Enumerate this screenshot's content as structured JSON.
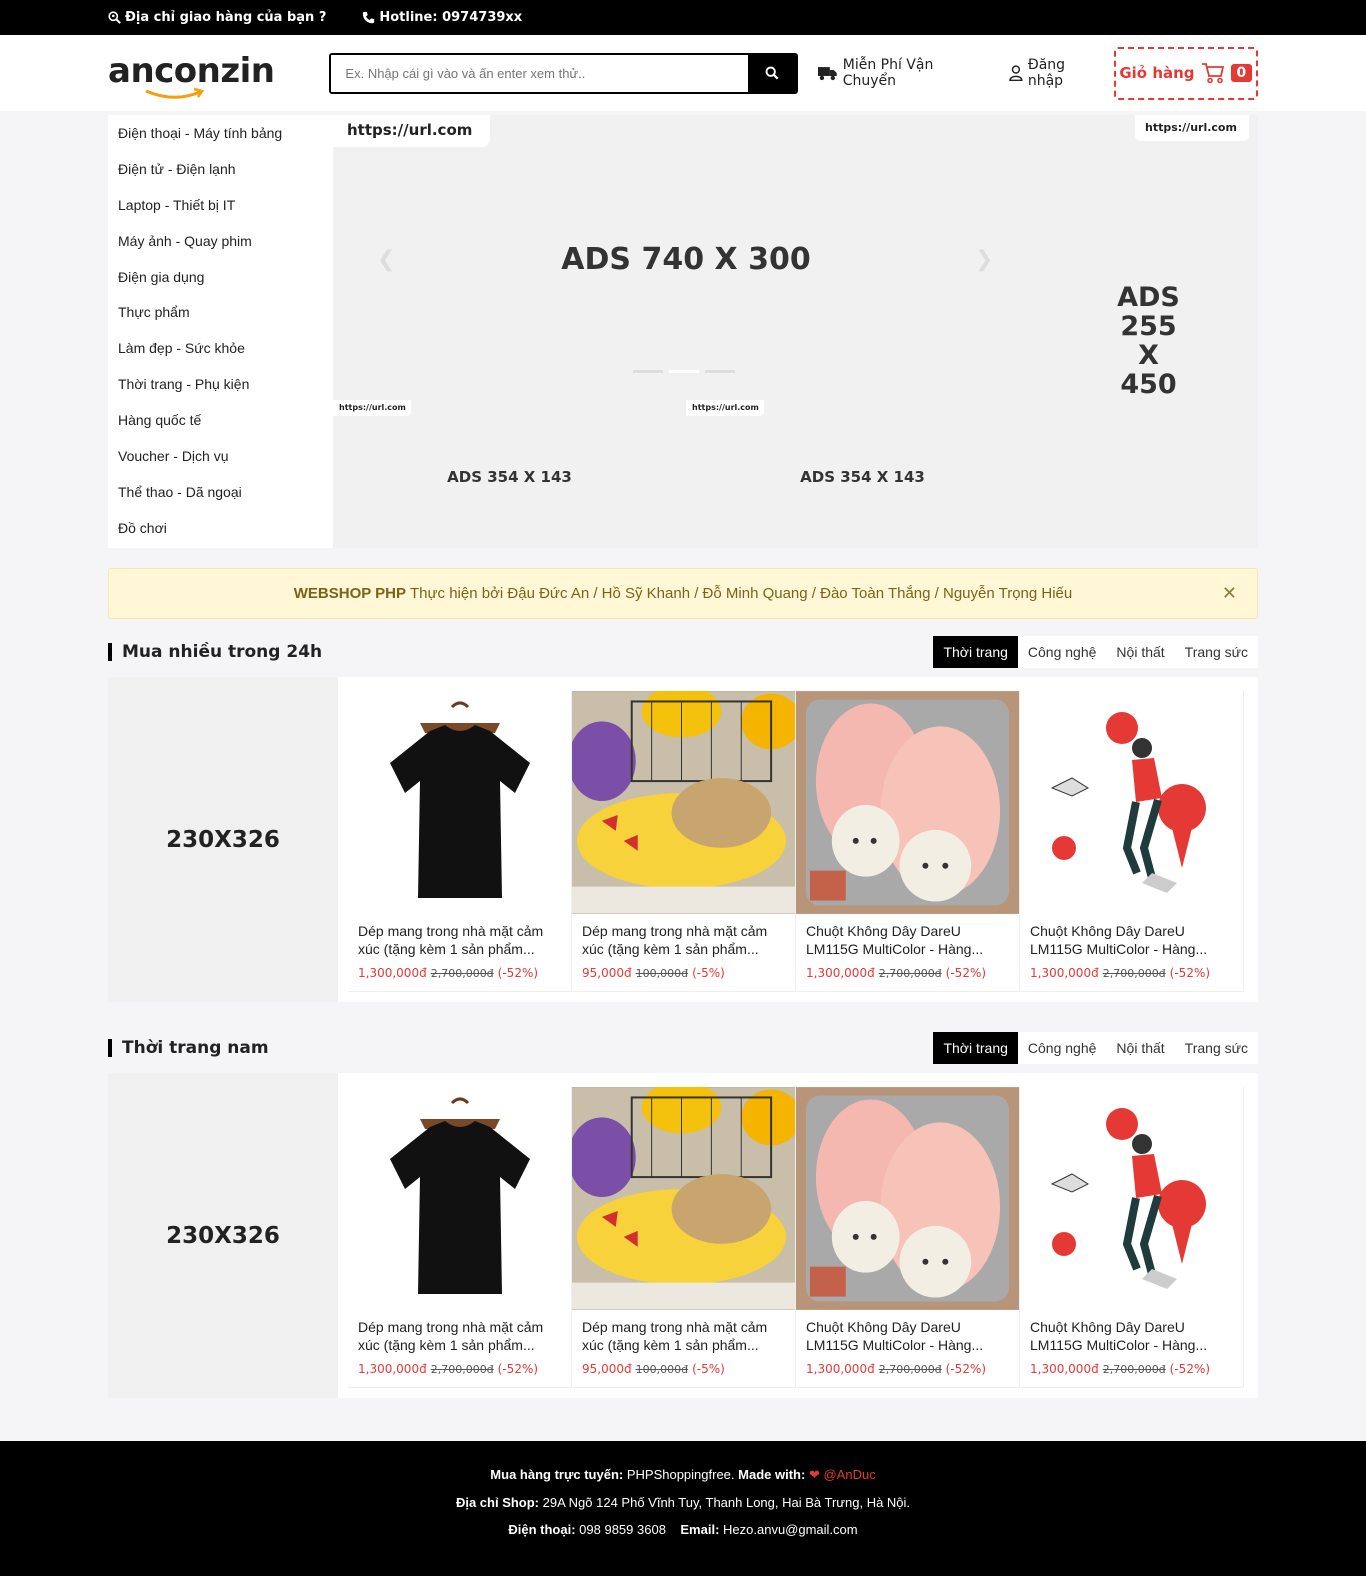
{
  "topbar": {
    "address": "Địa chỉ giao hàng của bạn ?",
    "hotline": "Hotline: 0974739xx"
  },
  "header": {
    "logo": "anconzin",
    "search_placeholder": "Ex. Nhập cái gì vào và ấn enter xem thử..",
    "shipping": "Miễn Phí Vận Chuyển",
    "login": "Đăng nhập",
    "cart_label": "Giỏ hàng",
    "cart_count": "0"
  },
  "menu": [
    "Điện thoại - Máy tính bảng",
    "Điện tử - Điện lạnh",
    "Laptop - Thiết bị IT",
    "Máy ảnh - Quay phim",
    "Điện gia dụng",
    "Thực phẩm",
    "Làm đẹp - Sức khỏe",
    "Thời trang - Phụ kiện",
    "Hàng quốc tế",
    "Voucher - Dịch vụ",
    "Thể thao - Dã ngoại",
    "Đồ chơi"
  ],
  "banners": {
    "main_url": "https://url.com",
    "main_text": "ADS 740 X 300",
    "small": [
      {
        "url": "https://url.com",
        "text": "ADS 354 X 143"
      },
      {
        "url": "https://url.com",
        "text": "ADS 354 X 143"
      }
    ],
    "right_url": "https://url.com",
    "right_text": [
      "ADS",
      "255",
      "X",
      "450"
    ]
  },
  "notice": {
    "brand": "WEBSHOP PHP",
    "text": "Thực hiện bởi Đậu Đức An / Hồ Sỹ Khanh / Đỗ Minh Quang / Đào Toàn Thắng / Nguyễn Trọng Hiếu"
  },
  "sections": [
    {
      "title": "Mua nhiều trong 24h",
      "tabs": [
        "Thời trang",
        "Công nghệ",
        "Nội thất",
        "Trang sức"
      ],
      "promo": "230X326",
      "products": [
        {
          "image": "tshirt",
          "name": "Dép mang trong nhà mặt cảm xúc (tặng kèm 1 sản phẩm...",
          "price": "1,300,000đ",
          "old": "2,700,000đ",
          "discount": "(-52%)"
        },
        {
          "image": "emoji-slipper",
          "name": "Dép mang trong nhà mặt cảm xúc (tặng kèm 1 sản phẩm...",
          "price": "95,000đ",
          "old": "100,000đ",
          "discount": "(-5%)"
        },
        {
          "image": "bear-slipper",
          "name": "Chuột Không Dây DareU LM115G MultiColor - Hàng...",
          "price": "1,300,000đ",
          "old": "2,700,000đ",
          "discount": "(-52%)"
        },
        {
          "image": "idea-illustration",
          "name": "Chuột Không Dây DareU LM115G MultiColor - Hàng...",
          "price": "1,300,000đ",
          "old": "2,700,000đ",
          "discount": "(-52%)"
        }
      ]
    },
    {
      "title": "Thời trang nam",
      "tabs": [
        "Thời trang",
        "Công nghệ",
        "Nội thất",
        "Trang sức"
      ],
      "promo": "230X326",
      "products": [
        {
          "image": "tshirt",
          "name": "Dép mang trong nhà mặt cảm xúc (tặng kèm 1 sản phẩm...",
          "price": "1,300,000đ",
          "old": "2,700,000đ",
          "discount": "(-52%)"
        },
        {
          "image": "emoji-slipper",
          "name": "Dép mang trong nhà mặt cảm xúc (tặng kèm 1 sản phẩm...",
          "price": "95,000đ",
          "old": "100,000đ",
          "discount": "(-5%)"
        },
        {
          "image": "bear-slipper",
          "name": "Chuột Không Dây DareU LM115G MultiColor - Hàng...",
          "price": "1,300,000đ",
          "old": "2,700,000đ",
          "discount": "(-52%)"
        },
        {
          "image": "idea-illustration",
          "name": "Chuột Không Dây DareU LM115G MultiColor - Hàng...",
          "price": "1,300,000đ",
          "old": "2,700,000đ",
          "discount": "(-52%)"
        }
      ]
    }
  ],
  "footer": {
    "line1_label": "Mua hàng trực tuyến:",
    "line1_value": "PHPShoppingfree.",
    "line1_made": "Made with:",
    "line1_author": "@AnDuc",
    "line2_label": "Địa chỉ Shop:",
    "line2_value": "29A Ngõ 124 Phố Vĩnh Tuy, Thanh Long, Hai Bà Trưng, Hà Nội.",
    "line3_phone_label": "Điện thoại:",
    "line3_phone": "098 9859 3608",
    "line3_email_label": "Email:",
    "line3_email": "Hezo.anvu@gmail.com"
  },
  "colors": {
    "accent": "#e53935",
    "dark": "#000000",
    "notice_bg": "#fff7d6"
  }
}
